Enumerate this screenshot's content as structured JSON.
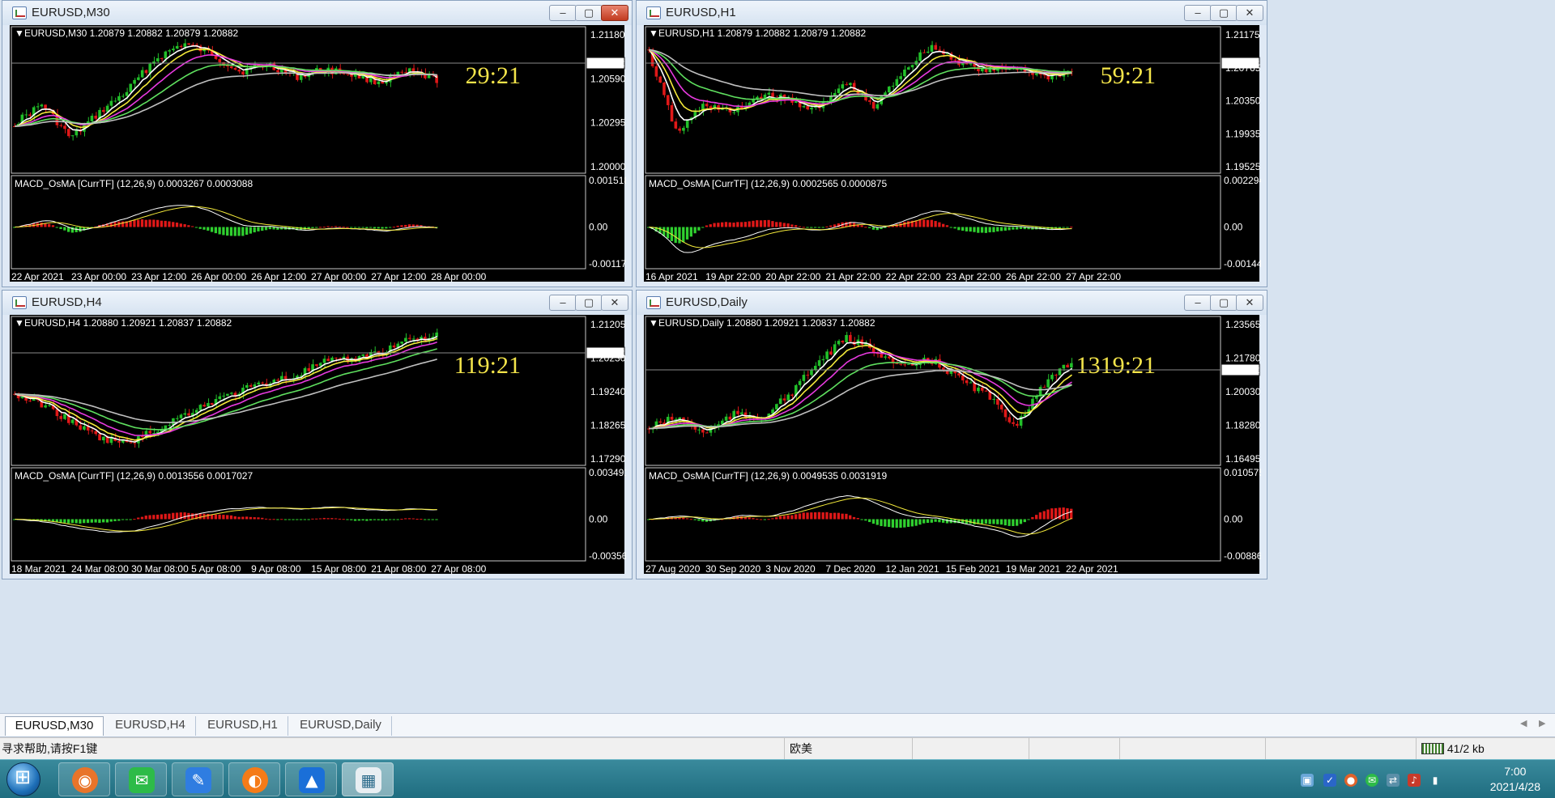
{
  "windows": [
    {
      "id": "m30",
      "title": "EURUSD,M30",
      "header": "EURUSD,M30  1.20879 1.20882 1.20879 1.20882",
      "countdown": "29:21",
      "price_ticks": [
        "1.21180",
        "1.20882",
        "1.20590",
        "1.20295",
        "1.20000"
      ],
      "current_price": "1.20882",
      "macd_header": "MACD_OsMA [CurrTF] (12,26,9) 0.0003267 0.0003088",
      "macd_ticks": [
        "0.0015187",
        "0.00",
        "-0.0011747"
      ],
      "dates": [
        "22 Apr 2021",
        "23 Apr 00:00",
        "23 Apr 12:00",
        "26 Apr 00:00",
        "26 Apr 12:00",
        "27 Apr 00:00",
        "27 Apr 12:00",
        "28 Apr 00:00"
      ],
      "active_title": true
    },
    {
      "id": "h1",
      "title": "EURUSD,H1",
      "header": "EURUSD,H1  1.20879 1.20882 1.20879 1.20882",
      "countdown": "59:21",
      "price_ticks": [
        "1.21175",
        "1.20882",
        "1.20765",
        "1.20350",
        "1.19935",
        "1.19525"
      ],
      "current_price": "1.20882",
      "macd_header": "MACD_OsMA [CurrTF] (12,26,9) 0.0002565 0.0000875",
      "macd_ticks": [
        "0.0022942",
        "0.00",
        "-0.0014412"
      ],
      "dates": [
        "16 Apr 2021",
        "19 Apr 22:00",
        "20 Apr 22:00",
        "21 Apr 22:00",
        "22 Apr 22:00",
        "23 Apr 22:00",
        "26 Apr 22:00",
        "27 Apr 22:00"
      ]
    },
    {
      "id": "h4",
      "title": "EURUSD,H4",
      "header": "EURUSD,H4  1.20880 1.20921 1.20837 1.20882",
      "countdown": "119:21",
      "price_ticks": [
        "1.21205",
        "1.20882",
        "1.20230",
        "1.19240",
        "1.18265",
        "1.17290"
      ],
      "current_price": "1.20882",
      "macd_header": "MACD_OsMA [CurrTF] (12,26,9) 0.0013556 0.0017027",
      "macd_ticks": [
        "0.0034914",
        "0.00",
        "-0.0035606"
      ],
      "dates": [
        "18 Mar 2021",
        "24 Mar 08:00",
        "30 Mar 08:00",
        "5 Apr 08:00",
        "9 Apr 08:00",
        "15 Apr 08:00",
        "21 Apr 08:00",
        "27 Apr 08:00"
      ]
    },
    {
      "id": "d1",
      "title": "EURUSD,Daily",
      "header": "EURUSD,Daily  1.20880 1.20921 1.20837 1.20882",
      "countdown": "1319:21",
      "price_ticks": [
        "1.23565",
        "1.21780",
        "1.20882",
        "1.20030",
        "1.18280",
        "1.16495"
      ],
      "current_price": "1.20882",
      "macd_header": "MACD_OsMA [CurrTF] (12,26,9) 0.0049535 0.0031919",
      "macd_ticks": [
        "0.0105757",
        "0.00",
        "-0.0088625"
      ],
      "dates": [
        "27 Aug 2020",
        "30 Sep 2020",
        "3 Nov 2020",
        "7 Dec 2020",
        "12 Jan 2021",
        "15 Feb 2021",
        "19 Mar 2021",
        "22 Apr 2021"
      ]
    }
  ],
  "window_buttons": {
    "minimize": "‒",
    "maximize": "▢",
    "close": "✕"
  },
  "tabs": [
    "EURUSD,M30",
    "EURUSD,H4",
    "EURUSD,H1",
    "EURUSD,Daily"
  ],
  "active_tab": "EURUSD,M30",
  "statusbar": {
    "help": "寻求帮助,请按F1键",
    "profile": "欧美",
    "traffic": "41/2 kb"
  },
  "taskbar": {
    "time": "7:00",
    "date": "2021/4/28"
  },
  "colors": {
    "bull": "#22c02a",
    "bear": "#e01818",
    "ma_fast": "#ffffff",
    "ma_yellow": "#f4ea3a",
    "ma_magenta": "#e83ae0",
    "ma_green": "#5fe05f",
    "ma_gray": "#bfbfbf",
    "hist_pos": "#e01818",
    "hist_neg": "#2fd02f"
  }
}
